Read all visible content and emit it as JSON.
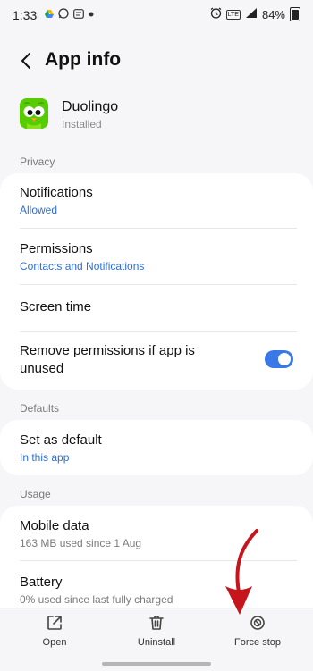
{
  "status_bar": {
    "time": "1:33",
    "battery": "84%",
    "net_label": "LTE"
  },
  "header": {
    "title": "App info"
  },
  "app": {
    "name": "Duolingo",
    "status": "Installed"
  },
  "sections": {
    "privacy": "Privacy",
    "defaults": "Defaults",
    "usage": "Usage"
  },
  "privacy_items": {
    "notifications": {
      "title": "Notifications",
      "sub": "Allowed"
    },
    "permissions": {
      "title": "Permissions",
      "sub": "Contacts and Notifications"
    },
    "screen_time": {
      "title": "Screen time"
    },
    "remove_perms": {
      "title_line1": "Remove permissions if app is",
      "title_line2": "unused",
      "enabled": true
    }
  },
  "defaults_items": {
    "set_default": {
      "title": "Set as default",
      "sub": "In this app"
    }
  },
  "usage_items": {
    "mobile_data": {
      "title": "Mobile data",
      "sub": "163 MB used since 1 Aug"
    },
    "battery": {
      "title": "Battery",
      "sub": "0% used since last fully charged"
    }
  },
  "actions": {
    "open": "Open",
    "uninstall": "Uninstall",
    "force_stop": "Force stop"
  },
  "colors": {
    "accent": "#3b78e7",
    "link": "#2f6fd1",
    "annotation": "#c4161c",
    "duo_green": "#58cc02"
  }
}
